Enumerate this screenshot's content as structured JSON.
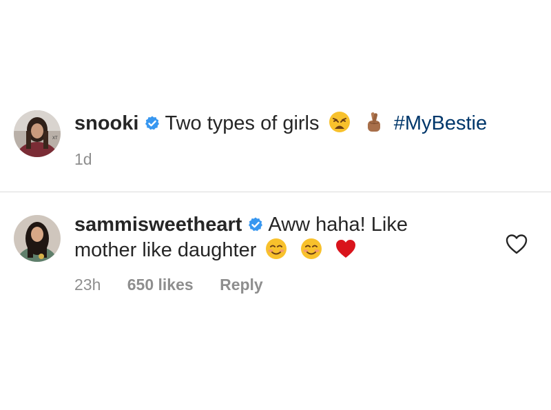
{
  "caption": {
    "username": "snooki",
    "text": "Two types of girls",
    "hashtag": "#MyBestie",
    "time": "1d",
    "emojis": [
      "weary-face-emoji",
      "crossed-fingers-emoji"
    ]
  },
  "comment": {
    "username": "sammisweetheart",
    "text_line1": "Aww haha! Like",
    "text_line2": "mother like daughter",
    "time": "23h",
    "likes": "650 likes",
    "reply_label": "Reply",
    "emojis": [
      "smiling-face-emoji",
      "smiling-face-emoji",
      "red-heart-emoji"
    ]
  },
  "colors": {
    "username": "#262626",
    "meta": "#8e8e8e",
    "hashtag": "#00376b",
    "verified": "#3897f0",
    "divider": "#dbdbdb"
  },
  "icons": [
    "verified-badge-icon",
    "heart-outline-icon"
  ]
}
